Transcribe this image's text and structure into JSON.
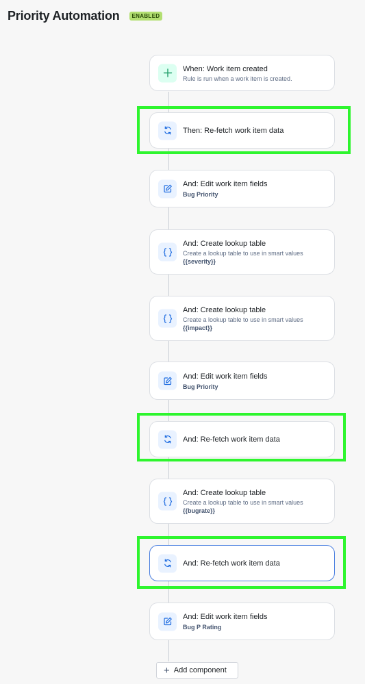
{
  "header": {
    "title": "Priority Automation",
    "status_badge": "ENABLED"
  },
  "colors": {
    "accent_blue": "#4a7fe0",
    "highlight_green": "#2ef52e",
    "badge_green": "#b3df72"
  },
  "steps": [
    {
      "title": "When: Work item created",
      "subtitle": "Rule is run when a work item is created.",
      "icon": "plus-icon"
    },
    {
      "title": "Then: Re-fetch work item data",
      "icon": "refresh-icon"
    },
    {
      "title": "And: Edit work item fields",
      "meta": "Bug Priority",
      "icon": "edit-icon"
    },
    {
      "title": "And: Create lookup table",
      "subtitle": "Create a lookup table to use in smart values",
      "meta": "{{severity}}",
      "icon": "braces-icon"
    },
    {
      "title": "And: Create lookup table",
      "subtitle": "Create a lookup table to use in smart values",
      "meta": "{{impact}}",
      "icon": "braces-icon"
    },
    {
      "title": "And: Edit work item fields",
      "meta": "Bug Priority",
      "icon": "edit-icon"
    },
    {
      "title": "And: Re-fetch work item data",
      "icon": "refresh-icon"
    },
    {
      "title": "And: Create lookup table",
      "subtitle": "Create a lookup table to use in smart values",
      "meta": "{{bugrate}}",
      "icon": "braces-icon"
    },
    {
      "title": "And: Re-fetch work item data",
      "icon": "refresh-icon",
      "selected": true
    },
    {
      "title": "And: Edit work item fields",
      "meta": "Bug P Rating",
      "icon": "edit-icon"
    }
  ],
  "add_component_label": "Add component"
}
